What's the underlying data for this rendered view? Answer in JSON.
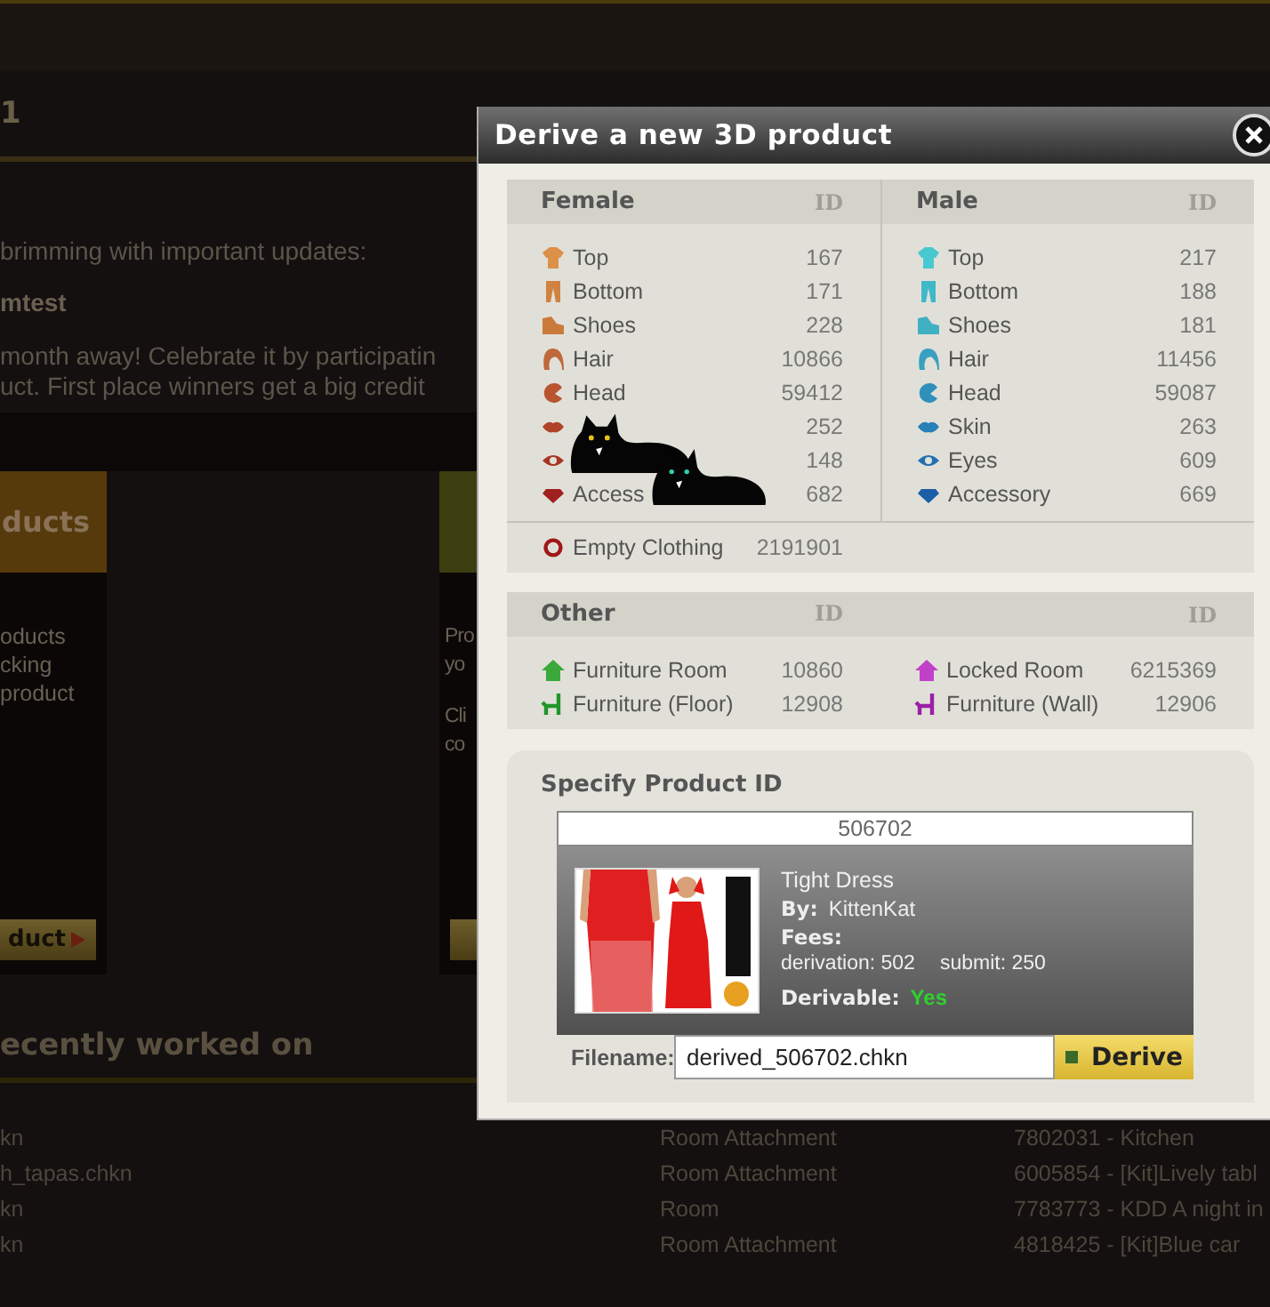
{
  "background": {
    "title": "1",
    "intro": "brimming with important updates:",
    "news_title": "mtest",
    "news_lines": [
      "month away! Celebrate it by participatin",
      "uct. First place winners get a big credit"
    ],
    "cards": [
      {
        "kind": "orange",
        "heading": "ducts",
        "paragraphs": [
          [
            "oducts",
            "cking",
            "product"
          ]
        ],
        "button": "duct"
      },
      {
        "kind": "green",
        "paragraphs": [
          [
            "Pro",
            "yo"
          ],
          [
            "Cli",
            "co"
          ]
        ]
      }
    ],
    "recent": {
      "title": "ecently worked on",
      "rows": [
        {
          "file": "kn",
          "type": "Room Attachment",
          "name": "7802031 - Kitchen"
        },
        {
          "file": "h_tapas.chkn",
          "type": "Room Attachment",
          "name": "6005854 - [Kit]Lively tabl"
        },
        {
          "file": "kn",
          "type": "Room",
          "name": "7783773 - KDD A night in"
        },
        {
          "file": "kn",
          "type": "Room Attachment",
          "name": "4818425 - [Kit]Blue car"
        }
      ]
    }
  },
  "dialog": {
    "title": "Derive a new 3D product",
    "clothing": {
      "groups": [
        {
          "kind": "female",
          "heading": "Female",
          "id_heading": "ID",
          "items": [
            {
              "label": "Top",
              "id": "167"
            },
            {
              "label": "Bottom",
              "id": "171"
            },
            {
              "label": "Shoes",
              "id": "228"
            },
            {
              "label": "Hair",
              "id": "10866"
            },
            {
              "label": "Head",
              "id": "59412"
            },
            {
              "id": "252"
            },
            {
              "id": "148"
            },
            {
              "label": "Access",
              "id": "682"
            }
          ]
        },
        {
          "kind": "male",
          "heading": "Male",
          "id_heading": "ID",
          "items": [
            {
              "label": "Top",
              "id": "217"
            },
            {
              "label": "Bottom",
              "id": "188"
            },
            {
              "label": "Shoes",
              "id": "181"
            },
            {
              "label": "Hair",
              "id": "11456"
            },
            {
              "label": "Head",
              "id": "59087"
            },
            {
              "label": "Skin",
              "id": "263"
            },
            {
              "label": "Eyes",
              "id": "609"
            },
            {
              "label": "Accessory",
              "id": "669"
            }
          ]
        }
      ],
      "extra": {
        "label": "Empty Clothing",
        "id": "2191901"
      }
    },
    "other": {
      "heading": "Other",
      "id_headings": [
        "ID",
        "ID"
      ],
      "items": [
        {
          "color": "#3aa83a",
          "label": "Furniture Room",
          "id": "10860"
        },
        {
          "color": "#c040c8",
          "label": "Locked Room",
          "id": "6215369"
        },
        {
          "color": "#20962a",
          "label": "Furniture (Floor)",
          "id": "12908"
        },
        {
          "color": "#9a20a8",
          "label": "Furniture (Wall)",
          "id": "12906"
        }
      ]
    },
    "specify": {
      "heading": "Specify Product ID",
      "product_id": "506702",
      "product": {
        "name": "Tight Dress",
        "by_label": "By:",
        "author": "KittenKat",
        "fees_label": "Fees:",
        "fees": [
          "derivation: 502",
          "submit: 250"
        ],
        "derivable_label": "Derivable:",
        "derivable": "Yes"
      },
      "filename_label": "Filename:",
      "filename": "derived_506702.chkn",
      "derive_button": "Derive"
    }
  }
}
